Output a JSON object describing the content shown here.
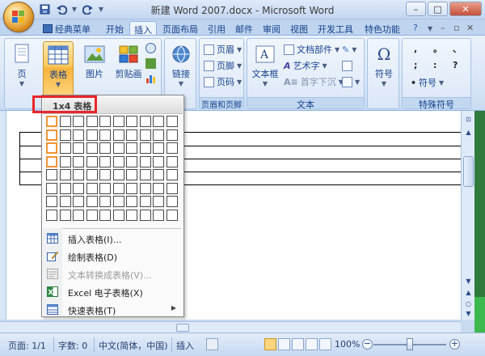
{
  "window": {
    "title": "新建 Word 2007.docx - Microsoft Word",
    "minimize": "–",
    "maximize": "□",
    "close": "✕"
  },
  "quick_access": {
    "save_icon": "save-icon",
    "undo_icon": "undo-icon",
    "redo_icon": "redo-icon"
  },
  "tabs": [
    "经典菜单",
    "开始",
    "插入",
    "页面布局",
    "引用",
    "邮件",
    "审阅",
    "视图",
    "开发工具",
    "特色功能"
  ],
  "active_tab": "插入",
  "ribbon": {
    "pages": {
      "label": "页"
    },
    "table": {
      "label": "表格"
    },
    "illustrations": {
      "picture": "图片",
      "clipart": "剪贴画"
    },
    "links": {
      "label": "链接"
    },
    "header_footer": {
      "header": "页眉",
      "footer": "页脚",
      "page_number": "页码",
      "group_label": "页眉和页脚"
    },
    "text": {
      "textbox": "文本框",
      "quickparts": "文档部件",
      "wordart": "艺术字",
      "dropcap": "首字下沉",
      "group_label": "文本"
    },
    "symbols": {
      "symbol": "符号",
      "special_symbol": "符号",
      "group_label": "特殊符号",
      "glyphs": [
        ",",
        "。",
        "、",
        ";",
        ":",
        "?"
      ]
    }
  },
  "dropdown": {
    "header": "1x4 表格",
    "grid_cols": 10,
    "grid_rows": 8,
    "selected_cols": 1,
    "selected_rows": 4,
    "items": [
      {
        "label": "插入表格(I)...",
        "icon": "insert-table-icon",
        "enabled": true,
        "submenu": false
      },
      {
        "label": "绘制表格(D)",
        "icon": "draw-table-icon",
        "enabled": true,
        "submenu": false
      },
      {
        "label": "文本转换成表格(V)...",
        "icon": "convert-text-icon",
        "enabled": false,
        "submenu": false
      },
      {
        "label": "Excel 电子表格(X)",
        "icon": "excel-icon",
        "enabled": true,
        "submenu": false
      },
      {
        "label": "快速表格(T)",
        "icon": "quick-table-icon",
        "enabled": true,
        "submenu": true
      }
    ]
  },
  "statusbar": {
    "page": "页面: 1/1",
    "words": "字数: 0",
    "language": "中文(简体，中国)",
    "mode": "插入",
    "zoom": "100%",
    "zoom_out": "−",
    "zoom_in": "+"
  },
  "colors": {
    "accent": "#15428b",
    "selection": "#f29436",
    "highlight": "#e8262a"
  }
}
